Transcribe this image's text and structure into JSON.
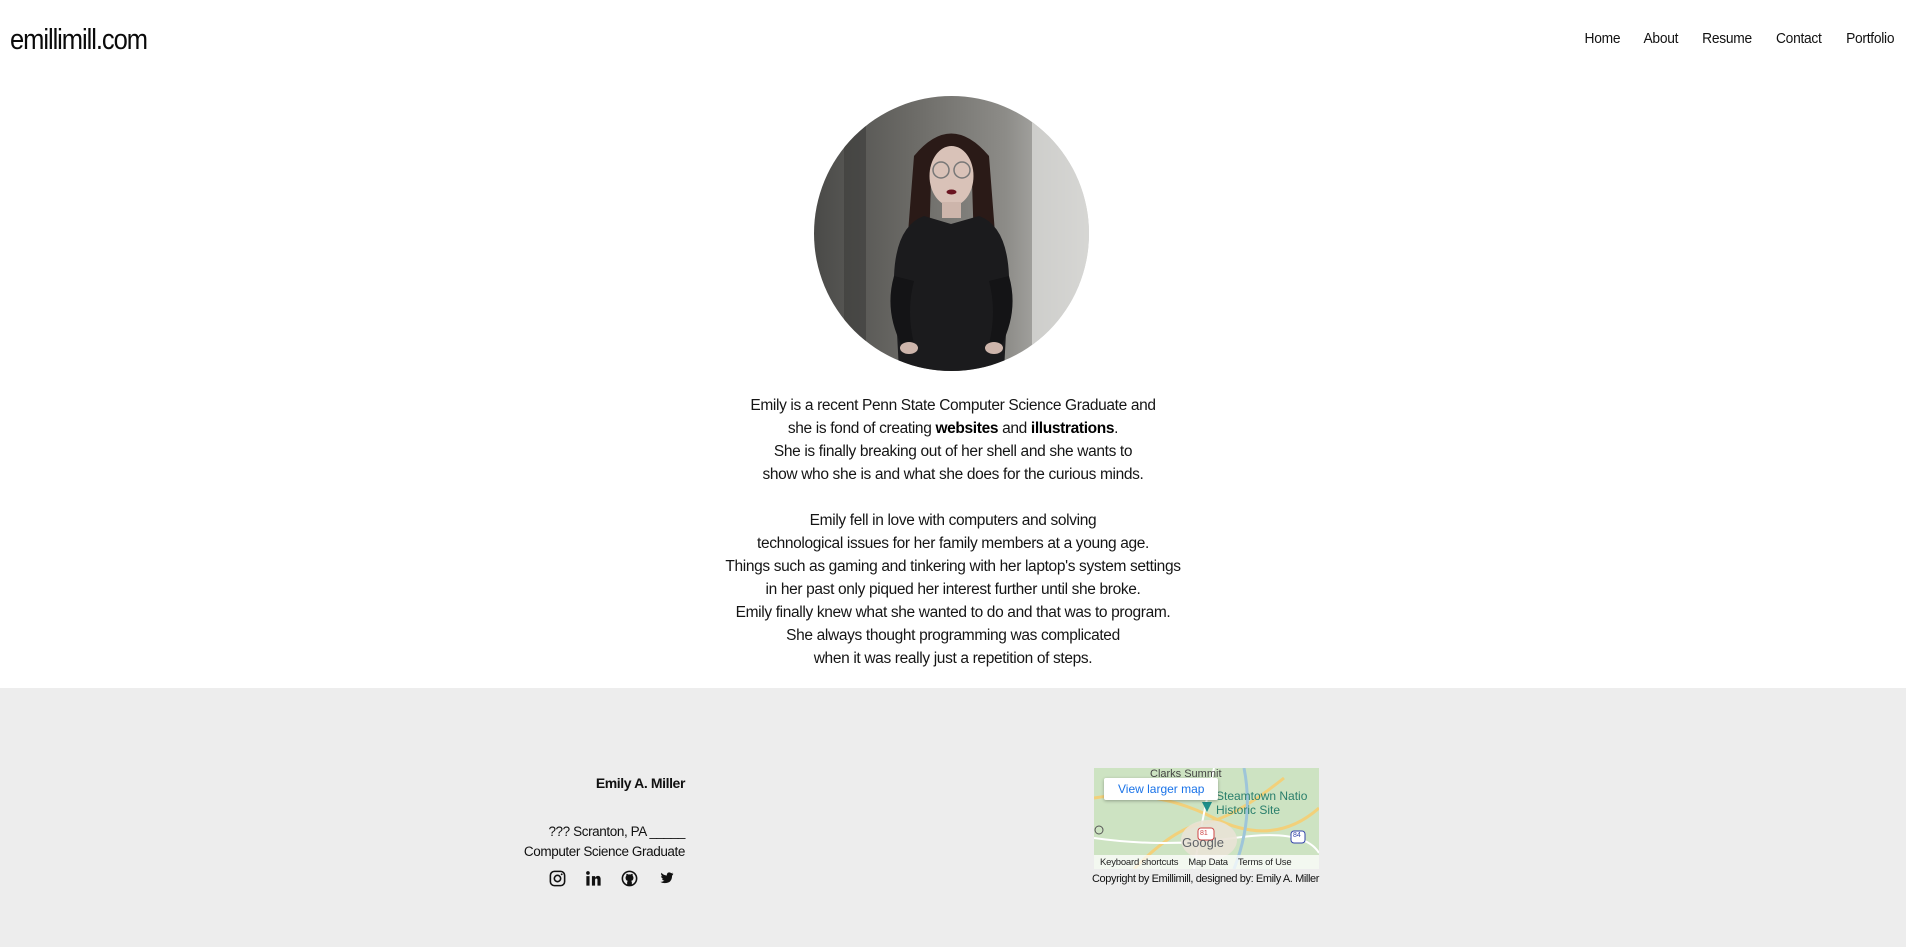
{
  "header": {
    "brand": "emillimill.com",
    "nav": [
      "Home",
      "About",
      "Resume",
      "Contact",
      "Portfolio"
    ]
  },
  "profile": {
    "photo_alt": "Emily portrait"
  },
  "bio": {
    "p1": {
      "l1": "Emily is a recent Penn State Computer Science Graduate and",
      "l2_before": "she is fond of creating ",
      "l2_bold1": "websites",
      "l2_mid": " and ",
      "l2_bold2": "illustrations",
      "l2_after": ".",
      "l3": "She is finally breaking out of her shell and she wants to",
      "l4": "show who she is and what she does for the curious minds."
    },
    "p2": [
      "Emily fell in love with computers and solving",
      "technological issues for her family members at a young age.",
      "Things such as gaming and tinkering with her laptop's system settings",
      "in her past only piqued her interest further until she broke.",
      "Emily finally knew what she wanted to do and that was to program.",
      "She always thought programming was complicated",
      "when it was really just a repetition of steps."
    ]
  },
  "footer": {
    "name": "Emily A. Miller",
    "address": "??? Scranton, PA _____",
    "title": "Computer Science Graduate",
    "socials": [
      "instagram-icon",
      "linkedin-icon",
      "github-icon",
      "twitter-icon"
    ],
    "map": {
      "button": "View larger map",
      "place1": "Clarks Summit",
      "place2": "Steamtown Natio",
      "place3": "Historic Site",
      "links": [
        "Keyboard shortcuts",
        "Map Data",
        "Terms of Use"
      ],
      "logo": "Google",
      "shield1": "81",
      "shield2": "84"
    },
    "copyright": "Copyright by Emillimill, designed by: Emily A. Miller"
  },
  "colors": {
    "footer_bg": "#ededed",
    "text": "#111111",
    "map_link": "#1a73e8"
  }
}
